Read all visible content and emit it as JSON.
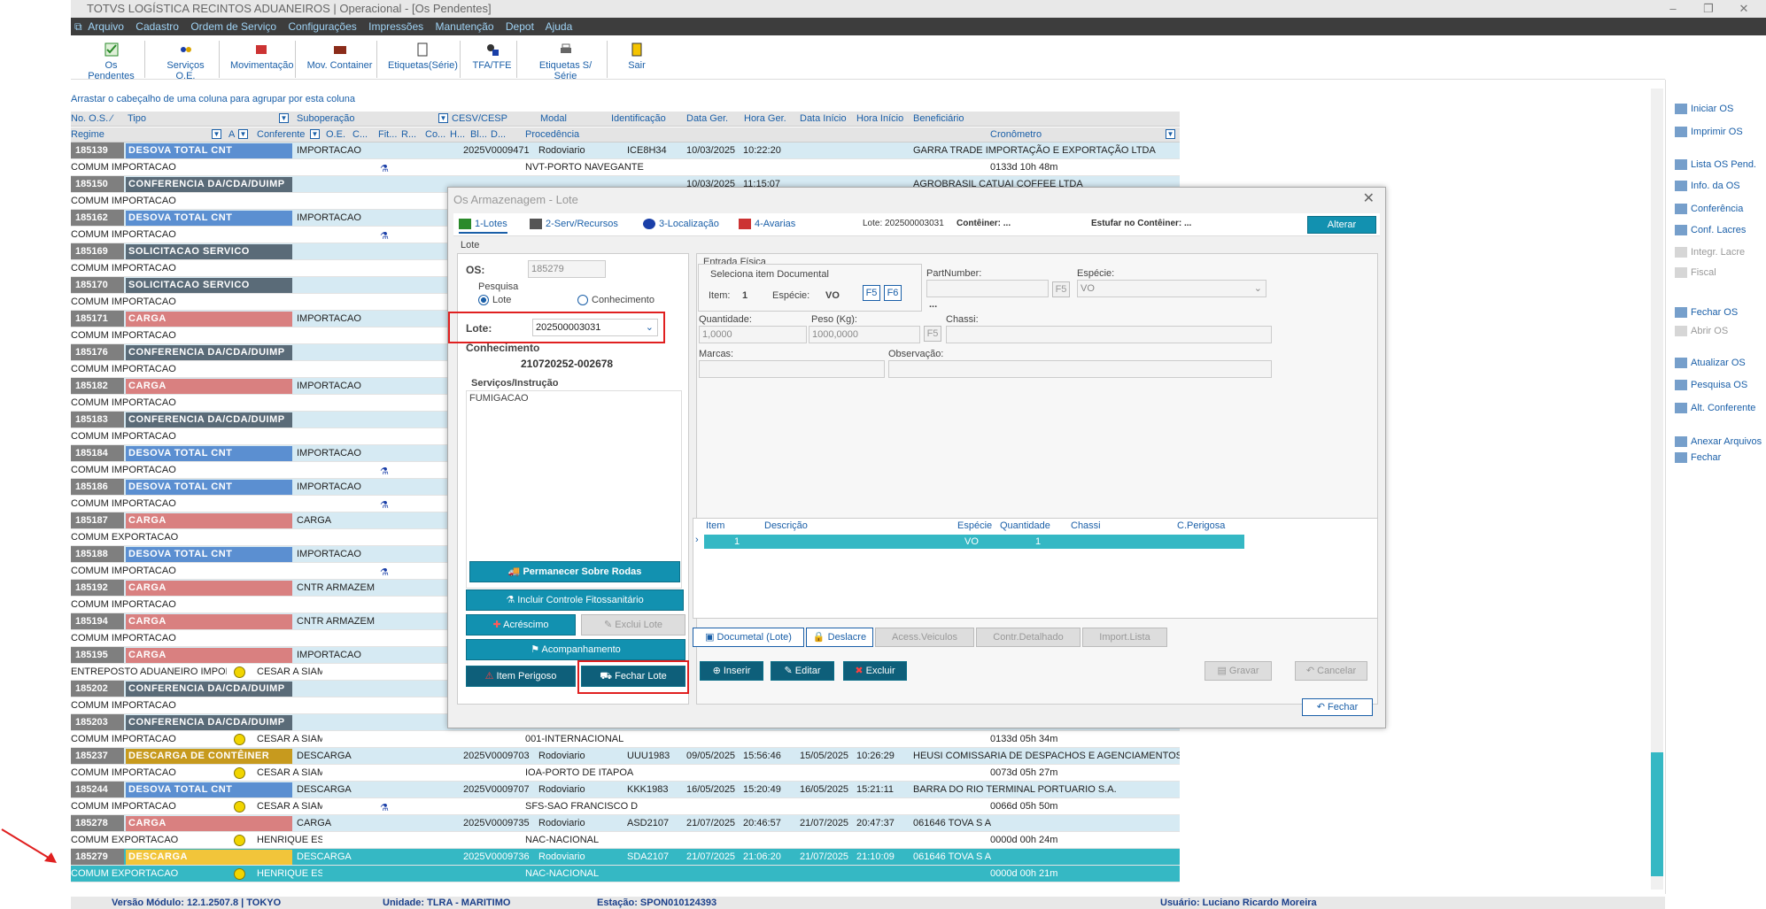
{
  "app": {
    "title": "TOTVS LOGÍSTICA RECINTOS ADUANEIROS | Operacional - [Os Pendentes]"
  },
  "menu": [
    "Arquivo",
    "Cadastro",
    "Ordem de Serviço",
    "Configurações",
    "Impressões",
    "Manutenção",
    "Depot",
    "Ajuda"
  ],
  "toolbar": [
    {
      "label": "Os Pendentes",
      "icon": "checklist-icon"
    },
    {
      "label": "Serviços O.E.",
      "icon": "services-icon"
    },
    {
      "label": "Movimentação",
      "icon": "movement-icon"
    },
    {
      "label": "Mov. Container",
      "icon": "container-icon"
    },
    {
      "label": "Etiquetas(Série)",
      "icon": "label-icon"
    },
    {
      "label": "TFA/TFE",
      "icon": "tfa-icon"
    },
    {
      "label": "Etiquetas S/ Série",
      "icon": "printer-icon"
    },
    {
      "label": "Sair",
      "icon": "exit-icon"
    }
  ],
  "grid": {
    "group_hint": "Arrastar o cabeçalho de uma coluna para agrupar por esta coluna",
    "header1": [
      "No. O.S. ⁄",
      "Tipo",
      "Suboperação",
      "CESV/CESP",
      "Modal",
      "Identificação",
      "Data Ger.",
      "Hora Ger.",
      "Data Início",
      "Hora Início",
      "Beneficiário"
    ],
    "header2": [
      "Regime",
      "A",
      "Conferente",
      "O.E.",
      "C...",
      "Fit...",
      "R...",
      "Co...",
      "H...",
      "Bl...",
      "D...",
      "Procedência",
      "Cronômetro"
    ],
    "rows": [
      {
        "num": "185139",
        "tipo": "DESOVA TOTAL CNT",
        "color": "#5b8fd1",
        "sub": "IMPORTACAO",
        "cesv": "2025V0009471",
        "modal": "Rodoviario",
        "ident": "ICE8H34",
        "dg": "10/03/2025",
        "hg": "10:22:20",
        "di": "",
        "hi": "",
        "benef": "GARRA TRADE IMPORTAÇÃO E EXPORTAÇÃO LTDA",
        "regime": "COMUM IMPORTACAO",
        "conf": "",
        "proc": "NVT-PORTO NAVEGANTE",
        "cron": "0133d 10h 48m",
        "flask": true,
        "smiley": false
      },
      {
        "num": "185150",
        "tipo": "CONFERENCIA DA/CDA/DUIMP",
        "color": "#5a6b78",
        "sub": "",
        "cesv": "",
        "modal": "",
        "ident": "",
        "dg": "10/03/2025",
        "hg": "11:15:07",
        "di": "",
        "hi": "",
        "benef": "AGROBRASIL CATUAI COFFEE LTDA",
        "regime": "COMUM IMPORTACAO",
        "conf": "",
        "proc": "",
        "cron": "",
        "flask": false,
        "smiley": false
      },
      {
        "num": "185162",
        "tipo": "DESOVA TOTAL CNT",
        "color": "#5b8fd1",
        "sub": "IMPORTACAO",
        "cesv": "",
        "modal": "",
        "ident": "",
        "dg": "",
        "hg": "",
        "di": "",
        "hi": "",
        "benef": "",
        "regime": "COMUM IMPORTACAO",
        "conf": "",
        "proc": "",
        "cron": "",
        "flask": true,
        "smiley": false
      },
      {
        "num": "185169",
        "tipo": "SOLICITACAO SERVICO",
        "color": "#5a6b78",
        "sub": "",
        "cesv": "",
        "modal": "",
        "ident": "",
        "dg": "",
        "hg": "",
        "di": "",
        "hi": "",
        "benef": "",
        "regime": "COMUM IMPORTACAO",
        "conf": "",
        "proc": "",
        "cron": "",
        "flask": false,
        "smiley": false
      },
      {
        "num": "185170",
        "tipo": "SOLICITACAO SERVICO",
        "color": "#5a6b78",
        "sub": "",
        "cesv": "",
        "modal": "",
        "ident": "",
        "dg": "",
        "hg": "",
        "di": "",
        "hi": "",
        "benef": "",
        "regime": "COMUM IMPORTACAO",
        "conf": "",
        "proc": "",
        "cron": "",
        "flask": false,
        "smiley": false
      },
      {
        "num": "185171",
        "tipo": "CARGA",
        "color": "#d98080",
        "sub": "IMPORTACAO",
        "cesv": "",
        "modal": "",
        "ident": "",
        "dg": "",
        "hg": "",
        "di": "",
        "hi": "",
        "benef": "",
        "regime": "COMUM IMPORTACAO",
        "conf": "",
        "proc": "",
        "cron": "",
        "flask": false,
        "smiley": false
      },
      {
        "num": "185176",
        "tipo": "CONFERENCIA DA/CDA/DUIMP",
        "color": "#5a6b78",
        "sub": "",
        "cesv": "",
        "modal": "",
        "ident": "",
        "dg": "",
        "hg": "",
        "di": "",
        "hi": "",
        "benef": "",
        "regime": "COMUM IMPORTACAO",
        "conf": "",
        "proc": "",
        "cron": "",
        "flask": false,
        "smiley": false
      },
      {
        "num": "185182",
        "tipo": "CARGA",
        "color": "#d98080",
        "sub": "IMPORTACAO",
        "cesv": "",
        "modal": "",
        "ident": "",
        "dg": "",
        "hg": "",
        "di": "",
        "hi": "",
        "benef": "",
        "regime": "COMUM IMPORTACAO",
        "conf": "",
        "proc": "",
        "cron": "",
        "flask": false,
        "smiley": false
      },
      {
        "num": "185183",
        "tipo": "CONFERENCIA DA/CDA/DUIMP",
        "color": "#5a6b78",
        "sub": "",
        "cesv": "",
        "modal": "",
        "ident": "",
        "dg": "",
        "hg": "",
        "di": "",
        "hi": "",
        "benef": "",
        "regime": "COMUM IMPORTACAO",
        "conf": "",
        "proc": "",
        "cron": "",
        "flask": false,
        "smiley": false
      },
      {
        "num": "185184",
        "tipo": "DESOVA TOTAL CNT",
        "color": "#5b8fd1",
        "sub": "IMPORTACAO",
        "cesv": "",
        "modal": "",
        "ident": "",
        "dg": "",
        "hg": "",
        "di": "",
        "hi": "",
        "benef": "",
        "regime": "COMUM IMPORTACAO",
        "conf": "",
        "proc": "",
        "cron": "",
        "flask": true,
        "smiley": false
      },
      {
        "num": "185186",
        "tipo": "DESOVA TOTAL CNT",
        "color": "#5b8fd1",
        "sub": "IMPORTACAO",
        "cesv": "",
        "modal": "",
        "ident": "",
        "dg": "",
        "hg": "",
        "di": "",
        "hi": "",
        "benef": "",
        "regime": "COMUM IMPORTACAO",
        "conf": "",
        "proc": "",
        "cron": "",
        "flask": true,
        "smiley": false
      },
      {
        "num": "185187",
        "tipo": "CARGA",
        "color": "#d98080",
        "sub": "CARGA",
        "cesv": "",
        "modal": "",
        "ident": "",
        "dg": "",
        "hg": "",
        "di": "",
        "hi": "",
        "benef": "",
        "regime": "COMUM EXPORTACAO",
        "conf": "",
        "proc": "",
        "cron": "",
        "flask": false,
        "smiley": false
      },
      {
        "num": "185188",
        "tipo": "DESOVA TOTAL CNT",
        "color": "#5b8fd1",
        "sub": "IMPORTACAO",
        "cesv": "",
        "modal": "",
        "ident": "",
        "dg": "",
        "hg": "",
        "di": "",
        "hi": "",
        "benef": "",
        "regime": "COMUM IMPORTACAO",
        "conf": "",
        "proc": "",
        "cron": "",
        "flask": true,
        "smiley": false
      },
      {
        "num": "185192",
        "tipo": "CARGA",
        "color": "#d98080",
        "sub": "CNTR ARMAZEM",
        "cesv": "",
        "modal": "",
        "ident": "",
        "dg": "",
        "hg": "",
        "di": "",
        "hi": "",
        "benef": "",
        "regime": "COMUM IMPORTACAO",
        "conf": "",
        "proc": "",
        "cron": "",
        "flask": false,
        "smiley": false
      },
      {
        "num": "185194",
        "tipo": "CARGA",
        "color": "#d98080",
        "sub": "CNTR ARMAZEM",
        "cesv": "",
        "modal": "",
        "ident": "",
        "dg": "",
        "hg": "",
        "di": "",
        "hi": "",
        "benef": "",
        "regime": "COMUM IMPORTACAO",
        "conf": "",
        "proc": "",
        "cron": "",
        "flask": false,
        "smiley": false
      },
      {
        "num": "185195",
        "tipo": "CARGA",
        "color": "#d98080",
        "sub": "IMPORTACAO",
        "cesv": "",
        "modal": "",
        "ident": "",
        "dg": "",
        "hg": "",
        "di": "",
        "hi": "",
        "benef": "",
        "regime": "ENTREPOSTO ADUANEIRO IMPOF",
        "conf": "CESAR A SIAM",
        "proc": "",
        "cron": "",
        "flask": false,
        "smiley": true
      },
      {
        "num": "185202",
        "tipo": "CONFERENCIA DA/CDA/DUIMP",
        "color": "#5a6b78",
        "sub": "",
        "cesv": "",
        "modal": "",
        "ident": "",
        "dg": "",
        "hg": "",
        "di": "",
        "hi": "",
        "benef": "",
        "regime": "COMUM IMPORTACAO",
        "conf": "",
        "proc": "",
        "cron": "",
        "flask": false,
        "smiley": false
      },
      {
        "num": "185203",
        "tipo": "CONFERENCIA DA/CDA/DUIMP",
        "color": "#5a6b78",
        "sub": "",
        "cesv": "",
        "modal": "",
        "ident": "",
        "dg": "",
        "hg": "",
        "di": "",
        "hi": "",
        "benef": "",
        "regime": "COMUM IMPORTACAO",
        "conf": "CESAR A SIAM",
        "proc": "001-INTERNACIONAL",
        "cron": "0133d 05h 34m",
        "flask": false,
        "smiley": true
      },
      {
        "num": "185237",
        "tipo": "DESCARGA DE CONTÊINER",
        "color": "#c79a1e",
        "sub": "DESCARGA",
        "cesv": "2025V0009703",
        "modal": "Rodoviario",
        "ident": "UUU1983",
        "dg": "09/05/2025",
        "hg": "15:56:46",
        "di": "15/05/2025",
        "hi": "10:26:29",
        "benef": "HEUSI COMISSARIA DE DESPACHOS E AGENCIAMENTOS",
        "regime": "COMUM IMPORTACAO",
        "conf": "CESAR A SIAM",
        "proc": "IOA-PORTO DE ITAPOA",
        "cron": "0073d 05h 27m",
        "flask": false,
        "smiley": true
      },
      {
        "num": "185244",
        "tipo": "DESOVA TOTAL CNT",
        "color": "#5b8fd1",
        "sub": "DESCARGA",
        "cesv": "2025V0009707",
        "modal": "Rodoviario",
        "ident": "KKK1983",
        "dg": "16/05/2025",
        "hg": "15:20:49",
        "di": "16/05/2025",
        "hi": "15:21:11",
        "benef": "BARRA DO RIO TERMINAL PORTUARIO S.A.",
        "regime": "COMUM IMPORTACAO",
        "conf": "CESAR A SIAM",
        "proc": "SFS-SAO FRANCISCO D",
        "cron": "0066d 05h 50m",
        "flask": true,
        "smiley": true
      },
      {
        "num": "185278",
        "tipo": "CARGA",
        "color": "#d98080",
        "sub": "CARGA",
        "cesv": "2025V0009735",
        "modal": "Rodoviario",
        "ident": "ASD2107",
        "dg": "21/07/2025",
        "hg": "20:46:57",
        "di": "21/07/2025",
        "hi": "20:47:37",
        "benef": "061646  TOVA S A",
        "regime": "COMUM EXPORTACAO",
        "conf": "HENRIQUE ES",
        "proc": "NAC-NACIONAL",
        "cron": "0000d 00h 24m",
        "flask": false,
        "smiley": true
      },
      {
        "num": "185279",
        "tipo": "DESCARGA",
        "color": "#f2c53a",
        "sub": "DESCARGA",
        "cesv": "2025V0009736",
        "modal": "Rodoviario",
        "ident": "SDA2107",
        "dg": "21/07/2025",
        "hg": "21:06:20",
        "di": "21/07/2025",
        "hi": "21:10:09",
        "benef": "061646  TOVA S A",
        "regime": "COMUM EXPORTACAO",
        "conf": "HENRIQUE ES",
        "proc": "NAC-NACIONAL",
        "cron": "0000d 00h 21m",
        "flask": false,
        "smiley": true,
        "selected": true
      }
    ]
  },
  "rightpanel": [
    {
      "label": "Iniciar OS",
      "icon": "start-icon",
      "enabled": true
    },
    {
      "label": "Imprimir OS",
      "icon": "print-icon",
      "enabled": true
    },
    {
      "label": "Lista OS Pend.",
      "icon": "list-icon",
      "enabled": true
    },
    {
      "label": "Info. da OS",
      "icon": "info-icon",
      "enabled": true
    },
    {
      "label": "Conferência",
      "icon": "smiley-icon",
      "enabled": true
    },
    {
      "label": "Conf. Lacres",
      "icon": "seal-icon",
      "enabled": true
    },
    {
      "label": "Integr. Lacre",
      "icon": "integrate-icon",
      "enabled": false
    },
    {
      "label": "Fiscal",
      "icon": "fiscal-icon",
      "enabled": false
    },
    {
      "label": "Fechar OS",
      "icon": "close-os-icon",
      "enabled": true
    },
    {
      "label": "Abrir OS",
      "icon": "checkbox-icon",
      "enabled": false
    },
    {
      "label": "Atualizar OS",
      "icon": "refresh-icon",
      "enabled": true
    },
    {
      "label": "Pesquisa OS",
      "icon": "search-icon",
      "enabled": true
    },
    {
      "label": "Alt. Conferente",
      "icon": "user-change-icon",
      "enabled": true
    },
    {
      "label": "Anexar Arquivos",
      "icon": "attach-icon",
      "enabled": true
    },
    {
      "label": "Fechar",
      "icon": "back-arrow-icon",
      "enabled": true
    }
  ],
  "status": {
    "versao": "Versão Módulo:  12.1.2507.8  |  TOKYO",
    "unidade": "Unidade:  TLRA - MARITIMO",
    "estacao": "Estação:  SPON010124393",
    "usuario": "Usuário:  Luciano Ricardo Moreira"
  },
  "modal": {
    "title": "Os Armazenagem - Lote",
    "tabs": [
      "1-Lotes",
      "2-Serv/Recursos",
      "3-Localização",
      "4-Avarias"
    ],
    "lote_info": "Lote:  202500003031",
    "conteiner_info": "Contêiner:  ...",
    "estufar_info": "Estufar no Contêiner:  ...",
    "alterar": "Alterar",
    "section": "Lote",
    "os_label": "OS:",
    "os_value": "185279",
    "pesquisa_label": "Pesquisa",
    "radio_lote": "Lote",
    "radio_conhec": "Conhecimento",
    "lote_label": "Lote:",
    "lote_value": "202500003031",
    "conhec_label": "Conhecimento",
    "conhec_value": "210720252-002678",
    "servicos_label": "Serviços/Instrução",
    "servicos_value": "FUMIGACAO",
    "entrada": "Entrada Física",
    "seleciona": "Seleciona item Documental",
    "item_label": "Item:",
    "item_value": "1",
    "especie_label": "Espécie:",
    "especie_value": "VO",
    "f5": "F5",
    "f6": "F6",
    "partnumber": "PartNumber:",
    "especie2": "Espécie:",
    "especie2_value": "VO",
    "dots": "...",
    "quantidade": "Quantidade:",
    "quantidade_value": "1,0000",
    "peso": "Peso (Kg):",
    "peso_value": "1000,0000",
    "chassi": "Chassi:",
    "marcas": "Marcas:",
    "observacao": "Observação:",
    "table_headers": [
      "Item",
      "Descrição",
      "Espécie",
      "Quantidade",
      "Chassi",
      "C.Perigosa"
    ],
    "table_row": [
      "1",
      "",
      "VO",
      "1",
      "",
      ""
    ],
    "subtabs": [
      "Documetal (Lote)",
      "Deslacre",
      "Acess.Veiculos",
      "Contr.Detalhado",
      "Import.Lista"
    ],
    "btn_permanecer": "Permanecer Sobre Rodas",
    "btn_incluir": "Incluir Controle Fitossanitário",
    "btn_acrescimo": "Acréscimo",
    "btn_exclui": "Exclui Lote",
    "btn_acompanhamento": "Acompanhamento",
    "btn_perigoso": "Item Perigoso",
    "btn_fechar_lote": "Fechar Lote",
    "btn_inserir": "Inserir",
    "btn_editar": "Editar",
    "btn_excluir": "Excluir",
    "btn_gravar": "Gravar",
    "btn_cancelar": "Cancelar",
    "btn_fechar": "Fechar"
  },
  "colors": {
    "accent": "#1291b0",
    "selected": "#35b8c4",
    "highlight": "#e02020"
  }
}
